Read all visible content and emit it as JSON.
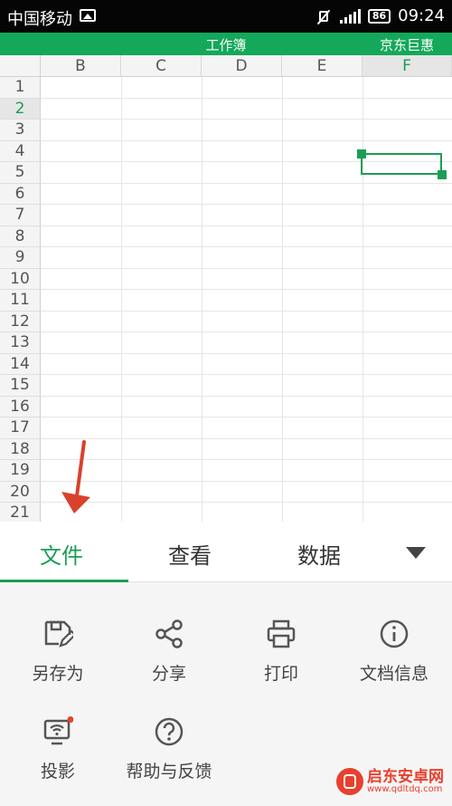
{
  "status_bar": {
    "carrier": "中国移动",
    "battery": "86",
    "time": "09:24"
  },
  "title_bar": {
    "title": "工作簿",
    "right_label": "京东巨惠"
  },
  "sheet": {
    "columns": [
      "B",
      "C",
      "D",
      "E",
      "F"
    ],
    "selected_column": "F",
    "rows": [
      "1",
      "2",
      "3",
      "4",
      "5",
      "6",
      "7",
      "8",
      "9",
      "10",
      "11",
      "12",
      "13",
      "14",
      "15",
      "16",
      "17",
      "18",
      "19",
      "20",
      "21"
    ],
    "selected_row": "2",
    "selected_cell": "F2"
  },
  "tabs": [
    {
      "label": "文件",
      "active": true
    },
    {
      "label": "查看",
      "active": false
    },
    {
      "label": "数据",
      "active": false
    }
  ],
  "tools": [
    {
      "label": "另存为",
      "icon": "save-as-icon"
    },
    {
      "label": "分享",
      "icon": "share-icon"
    },
    {
      "label": "打印",
      "icon": "print-icon"
    },
    {
      "label": "文档信息",
      "icon": "info-icon"
    },
    {
      "label": "投影",
      "icon": "projection-icon"
    },
    {
      "label": "帮助与反馈",
      "icon": "help-icon"
    }
  ],
  "watermark": {
    "line1": "启东安卓网",
    "line2": "www.qdltdq.com"
  },
  "colors": {
    "accent": "#13a85a",
    "annotation_arrow": "#d9412b"
  }
}
